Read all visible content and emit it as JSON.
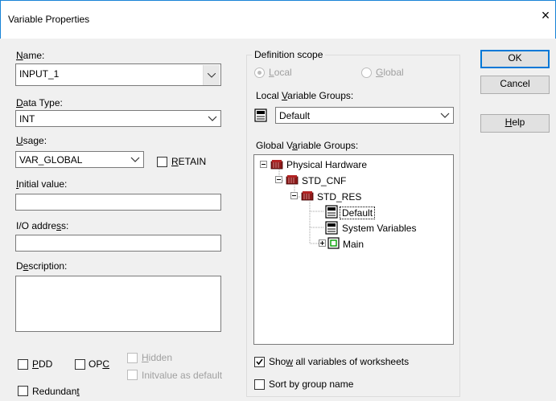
{
  "window": {
    "title": "Variable Properties",
    "close_glyph": "×"
  },
  "fields": {
    "name": {
      "label": "Name:",
      "value": "INPUT_1"
    },
    "data_type": {
      "label": "Data Type:",
      "value": "INT"
    },
    "usage": {
      "label": "Usage:",
      "value": "VAR_GLOBAL"
    },
    "retain": {
      "label": "RETAIN",
      "checked": false
    },
    "initial_value": {
      "label": "Initial value:",
      "value": ""
    },
    "io_address": {
      "label": "I/O address:",
      "value": ""
    },
    "description": {
      "label": "Description:",
      "value": ""
    }
  },
  "flags": {
    "pdd": {
      "label": "PDD",
      "checked": false
    },
    "opc": {
      "label": "OPC",
      "checked": false
    },
    "hidden": {
      "label": "Hidden",
      "checked": false,
      "enabled": false
    },
    "initvalue_default": {
      "label": "Initvalue as default",
      "checked": false,
      "enabled": false
    },
    "redundant": {
      "label": "Redundant",
      "checked": false
    }
  },
  "definition_scope": {
    "legend": "Definition scope",
    "local": {
      "label": "Local",
      "selected": true,
      "enabled": false
    },
    "global": {
      "label": "Global",
      "selected": false,
      "enabled": false
    },
    "local_groups_label": "Local Variable Groups:",
    "local_groups_value": "Default",
    "global_groups_label": "Global Variable Groups:",
    "tree": [
      {
        "label": "Physical Hardware",
        "icon": "hardware-icon",
        "expander": "minus"
      },
      {
        "label": "STD_CNF",
        "icon": "hardware-icon",
        "expander": "minus"
      },
      {
        "label": "STD_RES",
        "icon": "hardware-icon",
        "expander": "minus"
      },
      {
        "label": "Default",
        "icon": "variable-group-icon",
        "expander": "",
        "selected": true
      },
      {
        "label": "System Variables",
        "icon": "variable-group-icon",
        "expander": ""
      },
      {
        "label": "Main",
        "icon": "program-icon",
        "expander": "plus"
      }
    ],
    "show_all": {
      "label": "Show all variables of worksheets",
      "checked": true
    },
    "sort_by_group": {
      "label": "Sort by group name",
      "checked": false
    }
  },
  "buttons": {
    "ok": "OK",
    "cancel": "Cancel",
    "help": "Help"
  }
}
